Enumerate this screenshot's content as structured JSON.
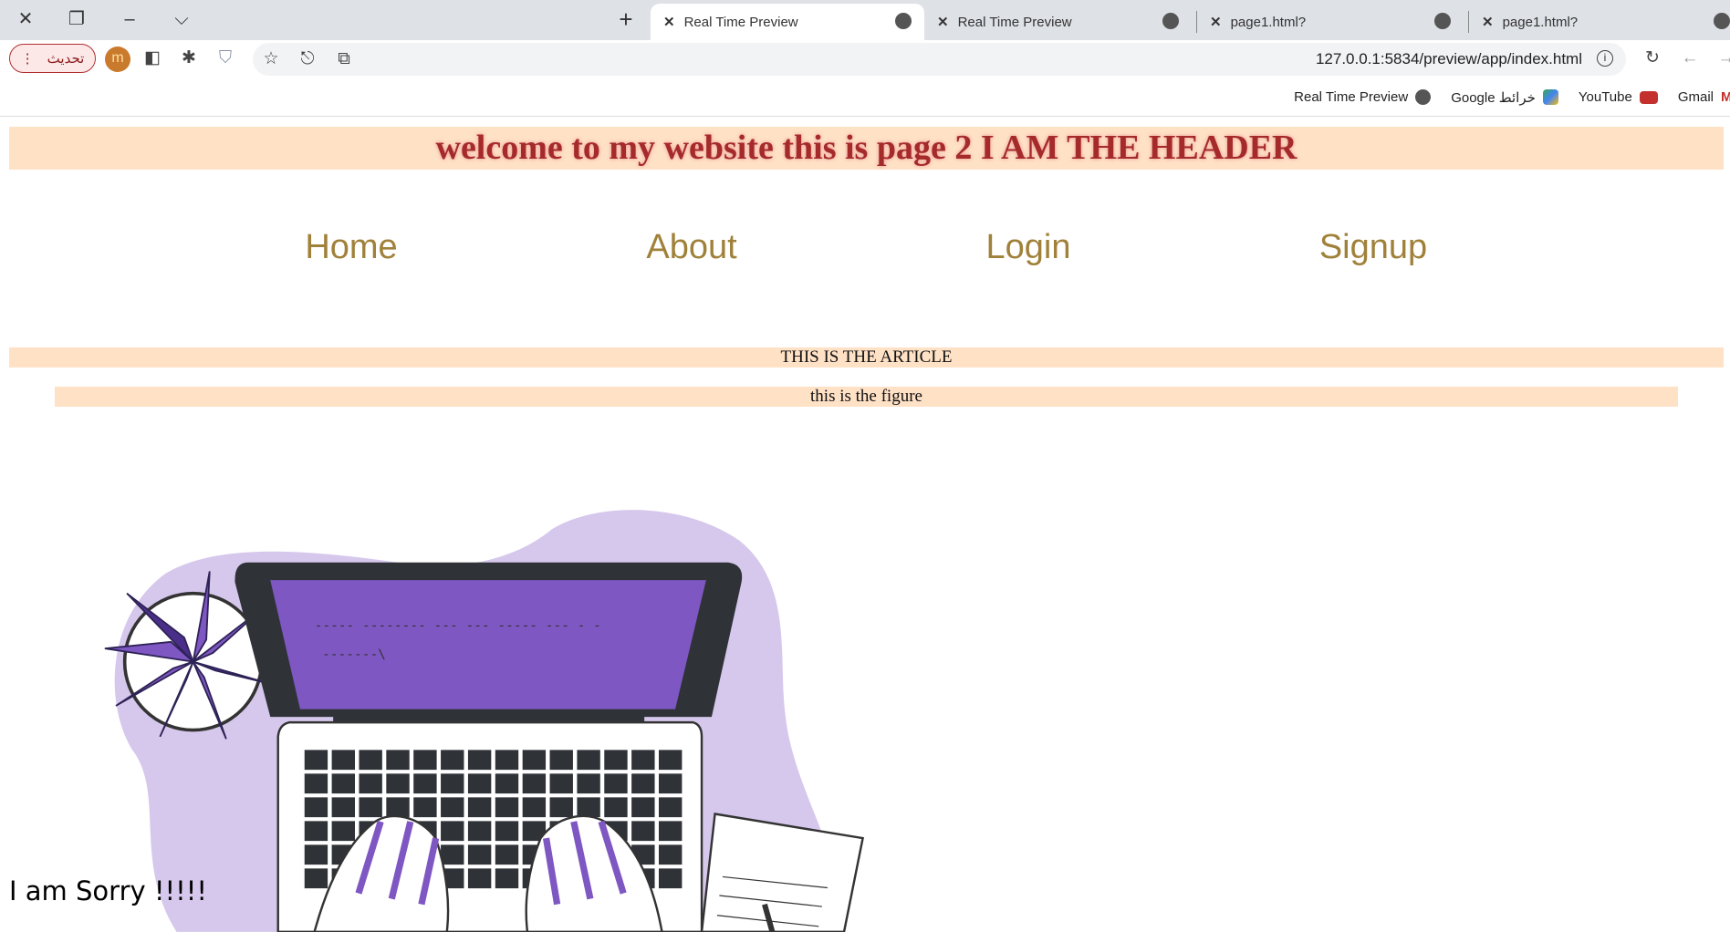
{
  "browser": {
    "tabs": [
      {
        "title": "Real Time Preview",
        "active": true
      },
      {
        "title": "Real Time Preview",
        "active": false
      },
      {
        "title": "page1.html?",
        "active": false
      },
      {
        "title": "page1.html?",
        "active": false
      }
    ],
    "update_button": "تحديث",
    "avatar_letter": "m",
    "url": "127.0.0.1:5834/preview/app/index.html",
    "bookmarks": [
      {
        "label": "Real Time Preview",
        "icon": "globe-icon"
      },
      {
        "label": "Google خرائط",
        "icon": "maps-icon"
      },
      {
        "label": "YouTube",
        "icon": "youtube-icon"
      },
      {
        "label": "Gmail",
        "icon": "gmail-icon"
      }
    ]
  },
  "page": {
    "header": "welcome to my website this is page 2 I AM THE HEADER",
    "nav": [
      "Home",
      "About",
      "Login",
      "Signup"
    ],
    "article": "THIS IS THE ARTICLE",
    "figure": "this is the figure",
    "screen_text": [
      "----- -------- --- ---    ----- --- - -",
      "-------\\"
    ],
    "sorry": "I am Sorry !!!!!"
  },
  "colors": {
    "header_bg": "#ffe1c6",
    "header_text": "#a52a2a",
    "nav": "#a0813a",
    "illustration_purple": "#7e57c2"
  }
}
